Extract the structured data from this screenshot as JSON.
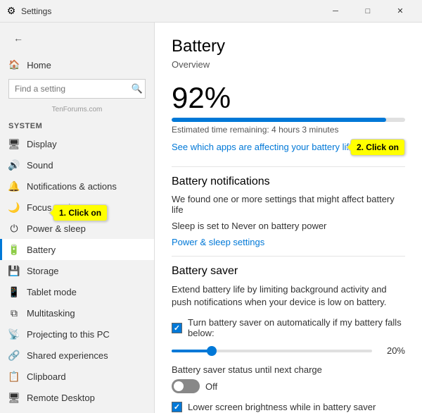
{
  "titleBar": {
    "title": "Settings",
    "minimize": "─",
    "maximize": "□",
    "close": "✕"
  },
  "sidebar": {
    "backBtn": "←",
    "homeLabel": "Home",
    "searchPlaceholder": "Find a setting",
    "searchIcon": "🔍",
    "watermark": "TenForums.com",
    "sectionHeader": "System",
    "items": [
      {
        "id": "display",
        "icon": "🖥",
        "label": "Display"
      },
      {
        "id": "sound",
        "icon": "🔊",
        "label": "Sound"
      },
      {
        "id": "notifications",
        "icon": "🔔",
        "label": "Notifications & actions"
      },
      {
        "id": "focus",
        "icon": "🌙",
        "label": "Focus assist"
      },
      {
        "id": "power",
        "icon": "⏻",
        "label": "Power & sleep"
      },
      {
        "id": "battery",
        "icon": "🔋",
        "label": "Battery",
        "active": true
      },
      {
        "id": "storage",
        "icon": "💾",
        "label": "Storage"
      },
      {
        "id": "tablet",
        "icon": "📱",
        "label": "Tablet mode"
      },
      {
        "id": "multitasking",
        "icon": "⧉",
        "label": "Multitasking"
      },
      {
        "id": "projecting",
        "icon": "📡",
        "label": "Projecting to this PC"
      },
      {
        "id": "shared",
        "icon": "🔗",
        "label": "Shared experiences"
      },
      {
        "id": "clipboard",
        "icon": "📋",
        "label": "Clipboard"
      },
      {
        "id": "remote",
        "icon": "🖥",
        "label": "Remote Desktop"
      }
    ]
  },
  "callout1": "1. Click on",
  "callout2": "2. Click on",
  "content": {
    "pageTitle": "Battery",
    "overviewLabel": "Overview",
    "batteryPercent": "92%",
    "progressPercent": 92,
    "estimatedTime": "Estimated time remaining: 4 hours 3 minutes",
    "linkText": "See which apps are affecting your battery life",
    "batteryNotificationsTitle": "Battery notifications",
    "notifDesc": "We found one or more settings that might affect battery life",
    "sleepSetting": "Sleep is set to Never on battery power",
    "powerSettingsLink": "Power & sleep settings",
    "batterySaverTitle": "Battery saver",
    "batterySaverDesc": "Extend battery life by limiting background activity and push notifications when your device is low on battery.",
    "checkboxLabel": "Turn battery saver on automatically if my battery falls below:",
    "sliderValue": "20%",
    "sliderPercent": 20,
    "toggleStatusLabel": "Battery saver status until next charge",
    "toggleState": "Off",
    "lowerBrightnessLabel": "Lower screen brightness while in battery saver"
  }
}
